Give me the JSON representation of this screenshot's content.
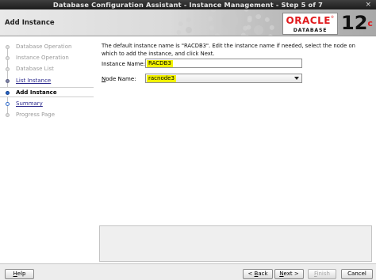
{
  "window": {
    "title": "Database Configuration Assistant - Instance Management - Step 5 of 7",
    "close_glyph": "×"
  },
  "banner": {
    "heading": "Add Instance",
    "brand": "ORACLE",
    "brand_mark": "®",
    "product": "DATABASE",
    "version": "12",
    "version_suffix": "c"
  },
  "steps": [
    {
      "label": "Database Operation",
      "state": "done"
    },
    {
      "label": "Instance Operation",
      "state": "done"
    },
    {
      "label": "Database List",
      "state": "done"
    },
    {
      "label": "List Instance",
      "state": "link"
    },
    {
      "label": "Add Instance",
      "state": "current"
    },
    {
      "label": "Summary",
      "state": "link"
    },
    {
      "label": "Progress Page",
      "state": "pending"
    }
  ],
  "form": {
    "description": "The default instance name is \"RACDB3\". Edit the instance name if needed, select the node on which to add the instance, and click Next.",
    "instance_label": "Instance Name:",
    "instance_value": "RACDB3",
    "node_label_accel": "N",
    "node_label_rest": "ode Name:",
    "node_value": "racnode3"
  },
  "footer": {
    "help_accel": "H",
    "help_rest": "elp",
    "back_arrow": "<",
    "back_accel": "B",
    "back_rest": "ack",
    "next_accel": "N",
    "next_rest": "ext",
    "next_arrow": ">",
    "finish_accel": "F",
    "finish_rest": "inish",
    "cancel": "Cancel"
  },
  "colors": {
    "highlight": "#f2f200",
    "oracle_red": "#e0191c",
    "step_link": "#2c2a8c"
  }
}
